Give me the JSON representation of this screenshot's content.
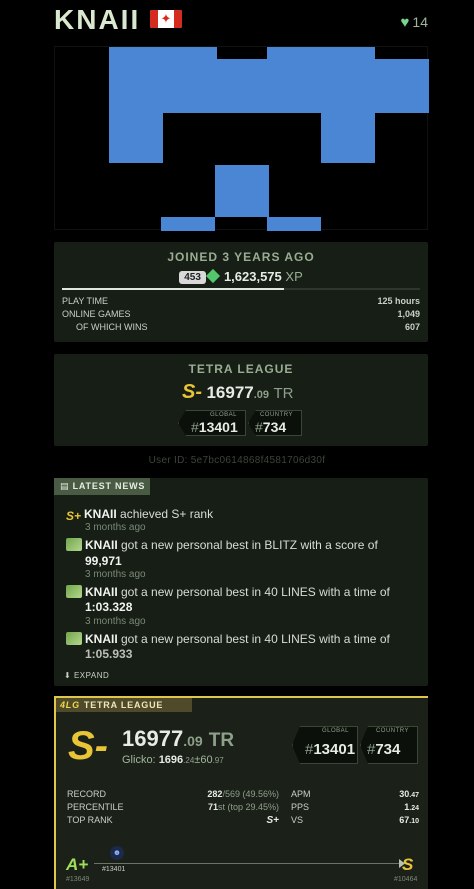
{
  "profile": {
    "username": "KNAII",
    "country_flag": "flag-icon-canada",
    "likes": "14",
    "avatar_color": "#4a86d4",
    "joined": "JOINED 3 YEARS AGO",
    "level": "453",
    "xp": "1,623,575",
    "xp_unit": "XP",
    "xp_progress": 0.62,
    "stats": [
      {
        "label": "PLAY TIME",
        "value": "125 hours"
      },
      {
        "label": "ONLINE GAMES",
        "value": "1,049"
      },
      {
        "label": "OF WHICH WINS",
        "value": "607"
      }
    ]
  },
  "league_summary": {
    "title": "TETRA LEAGUE",
    "rank": "S-",
    "tr_int": "16977",
    "tr_dec": ".09",
    "tr_unit": "TR",
    "global_label": "GLOBAL",
    "global_rank": "13401",
    "country_label": "COUNTRY",
    "country_rank": "734"
  },
  "user_id": "User ID: 5e7bc0614868f4581706d30f",
  "news": {
    "tab_label": "LATEST NEWS",
    "items": [
      {
        "user": "KNAII",
        "text": " achieved S+ rank",
        "value": "",
        "time": "3 months ago",
        "icon": "rank-splus-icon"
      },
      {
        "user": "KNAII",
        "text": " got a new personal best in BLITZ with a score of",
        "value": "99,971",
        "time": "3 months ago",
        "icon": "money-icon"
      },
      {
        "user": "KNAII",
        "text": " got a new personal best in 40 LINES with a time of",
        "value": "1:03.328",
        "time": "3 months ago",
        "icon": "money-icon"
      },
      {
        "user": "KNAII",
        "text": " got a new personal best in 40 LINES with a time of",
        "value": "1:05.933",
        "time": "",
        "icon": "money-icon"
      }
    ],
    "expand_label": "EXPAND"
  },
  "tetra_league": {
    "badge": "4LG",
    "tab_label": "TETRA LEAGUE",
    "rank": "S-",
    "tr_int": "16977",
    "tr_dec": ".09",
    "tr_unit": "TR",
    "glicko_label": "Glicko:",
    "glicko_int": "1696",
    "glicko_dec": ".24",
    "glicko_rd": "±60",
    "glicko_rd_dec": ".97",
    "global_label": "GLOBAL",
    "global_rank": "13401",
    "country_label": "COUNTRY",
    "country_rank": "734",
    "rows": [
      {
        "k1": "RECORD",
        "v1a": "282",
        "v1b": "/569 (49.56%)",
        "k2": "APM",
        "v2a": "30",
        "v2b": ".47"
      },
      {
        "k1": "PERCENTILE",
        "v1a": "71",
        "v1b": "st (top 29.45%)",
        "k2": "PPS",
        "v2a": "1",
        "v2b": ".24"
      },
      {
        "k1": "TOP RANK",
        "v1a": "S+",
        "v1b": "",
        "k2": "VS",
        "v2a": "67",
        "v2b": ".10"
      }
    ],
    "prev_rank": "A+",
    "prev_rank_num": "#13649",
    "current_num": "#13401",
    "next_rank": "S",
    "next_rank_num": "#10464",
    "progress": 0.07
  }
}
